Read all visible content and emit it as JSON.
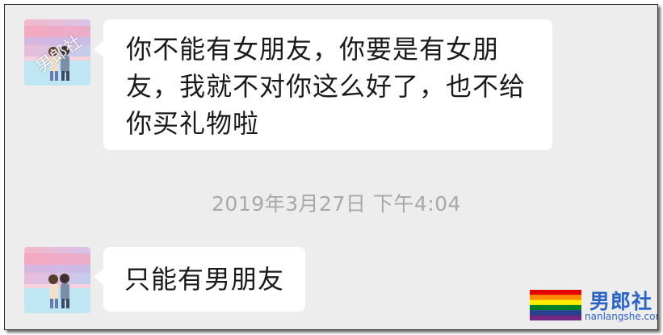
{
  "chat": {
    "messages": [
      {
        "sender": "other",
        "text": "你不能有女朋友，你要是有女朋友，我就不对你这么好了，也不给你买礼物啦"
      },
      {
        "sender": "other",
        "text": "只能有男朋友"
      }
    ],
    "timestamp": "2019年3月27日 下午4:04"
  },
  "watermark": {
    "text": "男郎社",
    "logo_cn": "男郎社",
    "logo_en": "nanlangshe.com"
  },
  "colors": {
    "chat_background": "#ededed",
    "bubble": "#ffffff",
    "timestamp_text": "#a8a8a8",
    "logo_text": "#2c63c6"
  }
}
